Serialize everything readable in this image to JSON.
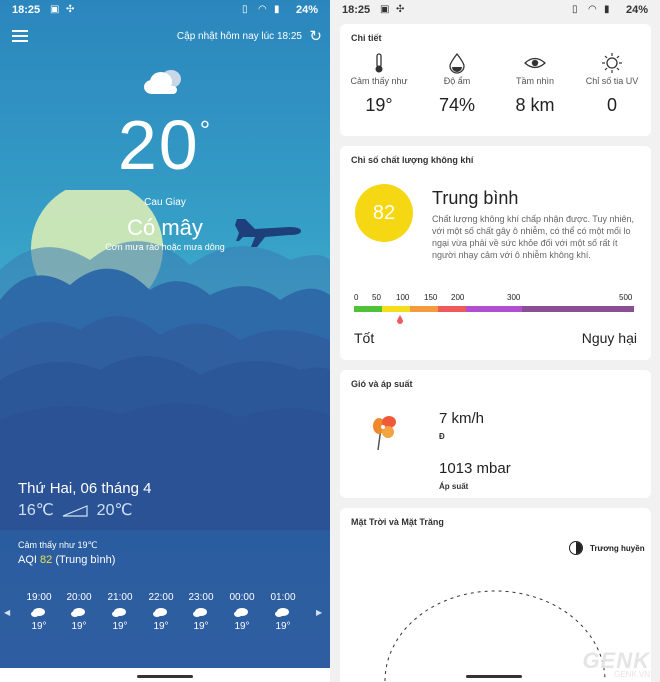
{
  "left": {
    "status": {
      "time": "18:25",
      "battery": "24%"
    },
    "header": {
      "update_text": "Cập nhật hôm nay lúc 18:25"
    },
    "current": {
      "temperature": "20",
      "degree_symbol": "°",
      "location": "Cau Giay",
      "condition": "Có mây",
      "forecast_note": "Cơn mưa rào hoặc mưa dông"
    },
    "today": {
      "date": "Thứ Hai, 06 tháng 4",
      "low": "16℃",
      "high": "20℃",
      "feels_like": "Cảm thấy như 19℃",
      "aqi_prefix": "AQI",
      "aqi_value": "82",
      "aqi_level": "(Trung bình)"
    },
    "hourly": [
      {
        "time": "19:00",
        "temp": "19°"
      },
      {
        "time": "20:00",
        "temp": "19°"
      },
      {
        "time": "21:00",
        "temp": "19°"
      },
      {
        "time": "22:00",
        "temp": "19°"
      },
      {
        "time": "23:00",
        "temp": "19°"
      },
      {
        "time": "00:00",
        "temp": "19°"
      },
      {
        "time": "01:00",
        "temp": "19°"
      }
    ]
  },
  "right": {
    "status": {
      "time": "18:25",
      "battery": "24%"
    },
    "details": {
      "title": "Chi tiết",
      "items": [
        {
          "label": "Cảm thấy như",
          "value": "19°",
          "icon": "thermometer-icon"
        },
        {
          "label": "Độ ẩm",
          "value": "74%",
          "icon": "humidity-drop-icon"
        },
        {
          "label": "Tầm nhìn",
          "value": "8 km",
          "icon": "eye-icon"
        },
        {
          "label": "Chỉ số tia UV",
          "value": "0",
          "icon": "sun-icon"
        }
      ]
    },
    "air_quality": {
      "title": "Chỉ số chất lượng không khí",
      "value": "82",
      "level": "Trung bình",
      "description": "Chất lượng không khí chấp nhận được. Tuy nhiên, với một số chất gây ô nhiễm, có thể có một mối lo ngại vừa phải về sức khỏe đối với một số rất ít người nhạy cảm với ô nhiễm không khí.",
      "scale_labels": [
        "0",
        "50",
        "100",
        "150",
        "200",
        "300",
        "500"
      ],
      "scale_colors": [
        "#4fc23a",
        "#f3df1c",
        "#f49a3f",
        "#f05a5a",
        "#b04fd0",
        "#8b4e94"
      ],
      "good_label": "Tốt",
      "bad_label": "Nguy hại"
    },
    "wind": {
      "title": "Gió và áp suất",
      "speed": "7 km/h",
      "direction": "Đ",
      "pressure": "1013 mbar",
      "pressure_label": "Áp suất"
    },
    "sun_moon": {
      "title": "Mặt Trời và Mặt Trăng",
      "moon_phase": "Trương huyền"
    },
    "watermark": {
      "brand": "GENK",
      "site": "GENK.VN"
    }
  }
}
